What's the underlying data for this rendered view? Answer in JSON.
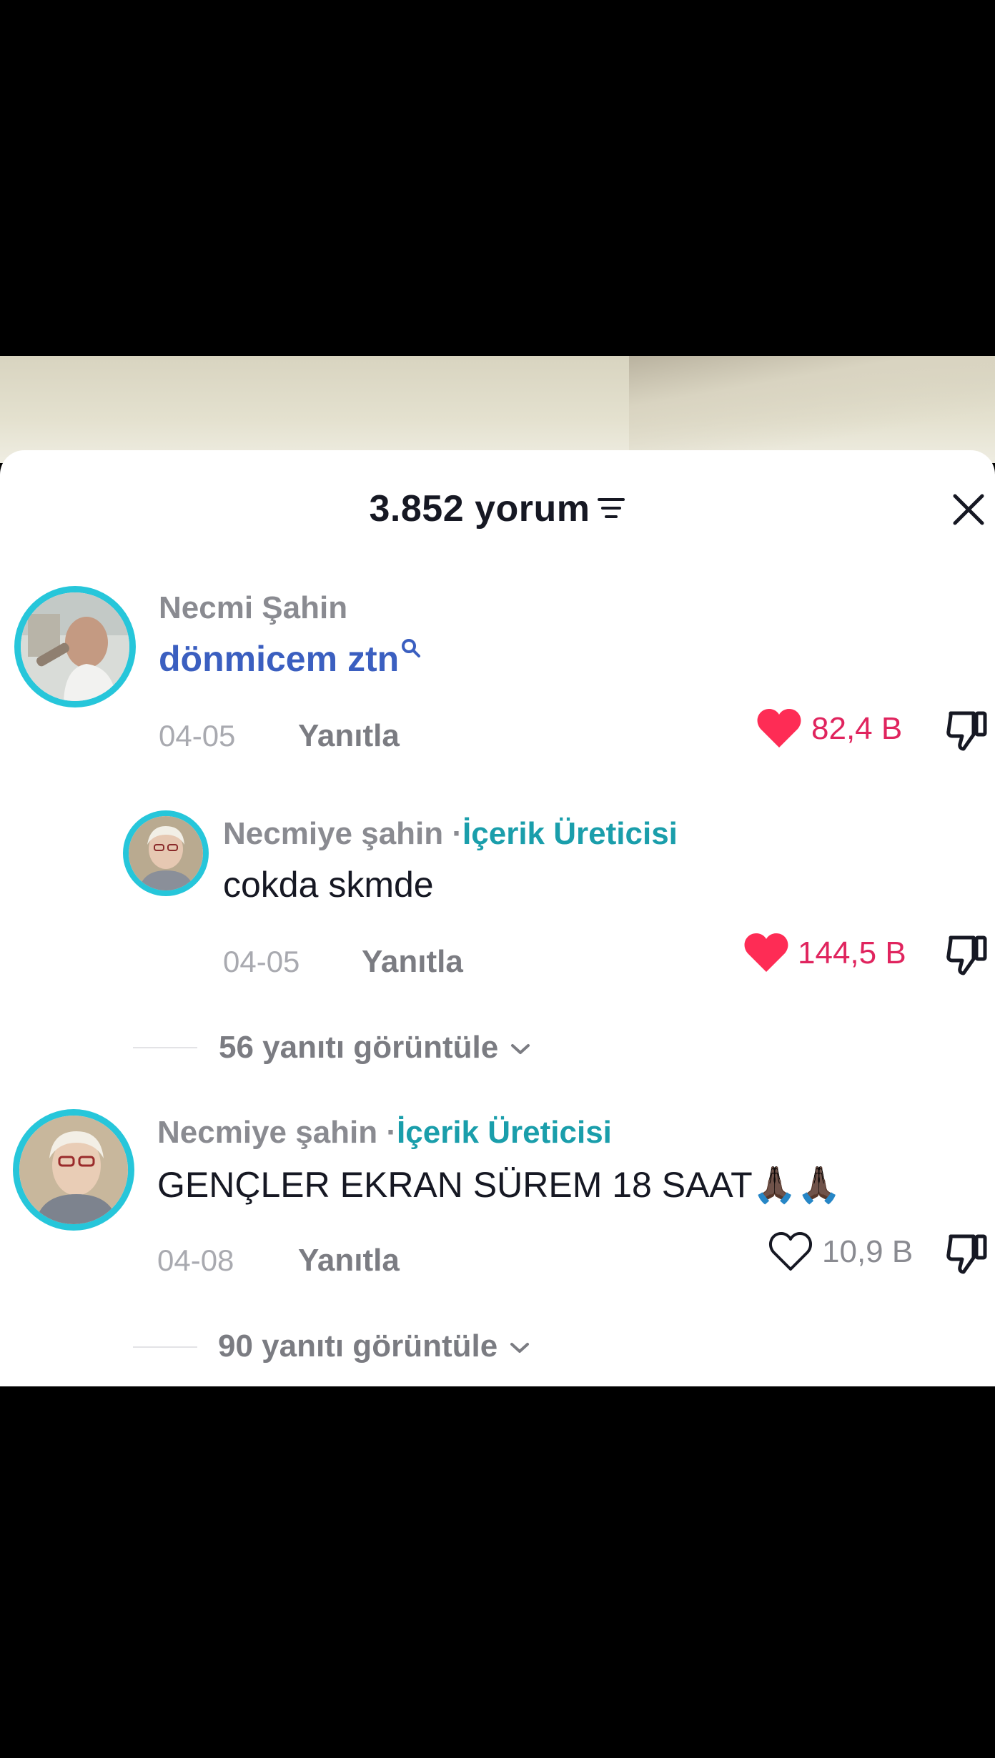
{
  "header": {
    "count_label": "3.852 yorum",
    "icons": {
      "sort": "sort-lines-icon",
      "close": "close-x-icon"
    }
  },
  "colors": {
    "liked": "#e0245e",
    "creator_label": "#1a9eab",
    "avatar_ring": "#26c6da",
    "link_blue": "#3b5fc0"
  },
  "comments": [
    {
      "username": "Necmi Şahin",
      "text": "dönmicem ztn",
      "text_is_search_link": true,
      "date": "04-05",
      "reply_label": "Yanıtla",
      "likes": "82,4 B",
      "liked": true,
      "replies": [
        {
          "username": "Necmiye şahin",
          "separator": "·",
          "badge": "İçerik Üreticisi",
          "text": "cokda skmde",
          "date": "04-05",
          "reply_label": "Yanıtla",
          "likes": "144,5 B",
          "liked": true
        }
      ],
      "view_replies": "56 yanıtı görüntüle"
    },
    {
      "username": "Necmiye şahin",
      "separator": "·",
      "badge": "İçerik Üreticisi",
      "text": "GENÇLER EKRAN SÜREM 18 SAAT🙏🏿🙏🏿",
      "date": "04-08",
      "reply_label": "Yanıtla",
      "likes": "10,9 B",
      "liked": false,
      "view_replies": "90 yanıtı görüntüle"
    }
  ]
}
